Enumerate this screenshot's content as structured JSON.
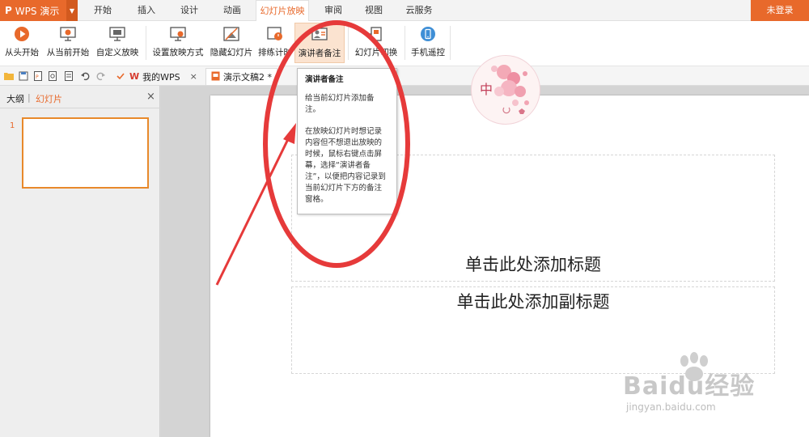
{
  "app": {
    "name": "WPS 演示",
    "logo": "P"
  },
  "menu": {
    "tabs": [
      "开始",
      "插入",
      "设计",
      "动画",
      "幻灯片放映",
      "审阅",
      "视图",
      "云服务"
    ],
    "active": "幻灯片放映",
    "login_label": "未登录"
  },
  "ribbon": {
    "buttons": [
      {
        "label": "从头开始",
        "icon": "play-from-start-icon"
      },
      {
        "label": "从当前开始",
        "icon": "play-from-current-icon"
      },
      {
        "label": "自定义放映",
        "icon": "custom-show-icon"
      },
      {
        "label": "设置放映方式",
        "icon": "show-settings-icon"
      },
      {
        "label": "隐藏幻灯片",
        "icon": "hide-slide-icon"
      },
      {
        "label": "排练计时",
        "icon": "rehearse-timing-icon"
      },
      {
        "label": "演讲者备注",
        "icon": "speaker-notes-icon"
      },
      {
        "label": "幻灯片切换",
        "icon": "slide-transition-icon"
      },
      {
        "label": "手机遥控",
        "icon": "phone-remote-icon"
      }
    ],
    "active": "演讲者备注"
  },
  "docbar": {
    "tabs": [
      {
        "label": "我的WPS",
        "icon": "wps-logo-icon"
      },
      {
        "label": "演示文稿2 *",
        "icon": "presentation-file-icon"
      }
    ],
    "close_glyph": "×"
  },
  "sidebar": {
    "tabs": [
      "大纲",
      "幻灯片"
    ],
    "active": "幻灯片",
    "separator": "|",
    "close_glyph": "×",
    "slides": [
      {
        "number": "1"
      }
    ]
  },
  "slide": {
    "title_placeholder": "单击此处添加标题",
    "subtitle_placeholder": "单击此处添加副标题"
  },
  "tooltip": {
    "title": "演讲者备注",
    "p1": "给当前幻灯片添加备注。",
    "p2": "在放映幻灯片时想记录内容但不想退出放映的时候，鼠标右键点击屏幕，选择“演讲者备注”，以便把内容记录到当前幻灯片下方的备注窗格。"
  },
  "sticker": {
    "char": "中"
  },
  "watermark": {
    "brand": "Baidu经验",
    "url": "jingyan.baidu.com"
  },
  "colors": {
    "accent": "#e8692b",
    "annotation": "#e63a3a"
  }
}
